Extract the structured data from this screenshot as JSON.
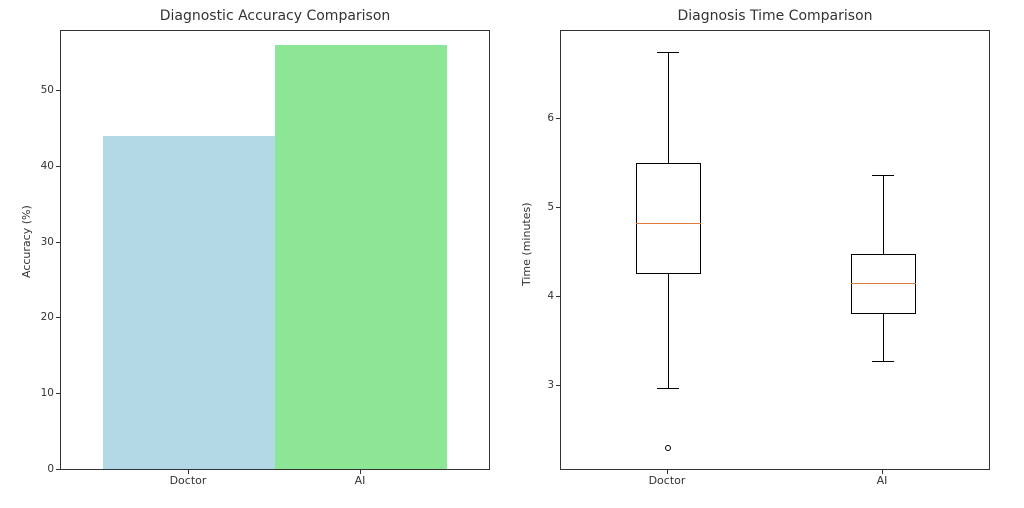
{
  "chart_data": [
    {
      "type": "bar",
      "title": "Diagnostic Accuracy Comparison",
      "xlabel": "",
      "ylabel": "Accuracy (%)",
      "categories": [
        "Doctor",
        "AI"
      ],
      "values": [
        44,
        56
      ],
      "ylim": [
        0,
        58
      ],
      "yticks": [
        0,
        10,
        20,
        30,
        40,
        50
      ],
      "colors": [
        "#b3d9e6",
        "#8ce696"
      ]
    },
    {
      "type": "boxplot",
      "title": "Diagnosis Time Comparison",
      "xlabel": "",
      "ylabel": "Time (minutes)",
      "categories": [
        "Doctor",
        "AI"
      ],
      "series": [
        {
          "name": "Doctor",
          "q1": 4.26,
          "median": 4.84,
          "q3": 5.51,
          "whisker_low": 2.98,
          "whisker_high": 6.76,
          "outliers": [
            2.31
          ]
        },
        {
          "name": "AI",
          "q1": 3.82,
          "median": 4.17,
          "q3": 4.49,
          "whisker_low": 3.29,
          "whisker_high": 5.38,
          "outliers": []
        }
      ],
      "ylim": [
        2.05,
        7.0
      ],
      "yticks": [
        3,
        4,
        5,
        6
      ]
    }
  ]
}
